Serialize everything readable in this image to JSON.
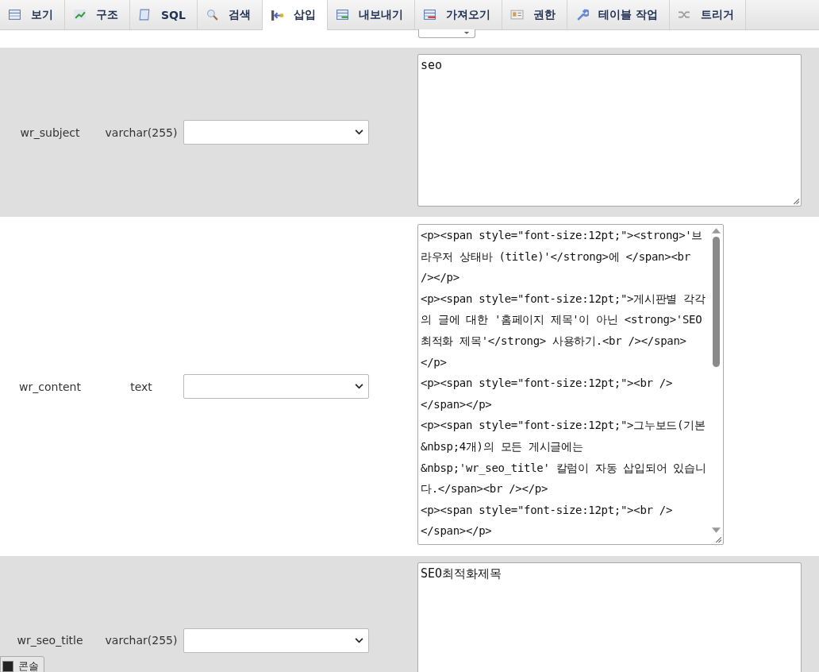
{
  "tabs": [
    {
      "label": "보기",
      "selected": false
    },
    {
      "label": "구조",
      "selected": false
    },
    {
      "label": "SQL",
      "selected": false
    },
    {
      "label": "검색",
      "selected": false
    },
    {
      "label": "삽입",
      "selected": true
    },
    {
      "label": "내보내기",
      "selected": false
    },
    {
      "label": "가져오기",
      "selected": false
    },
    {
      "label": "권한",
      "selected": false
    },
    {
      "label": "테이블 작업",
      "selected": false
    },
    {
      "label": "트리거",
      "selected": false
    }
  ],
  "rows": [
    {
      "name": "wr_subject",
      "type": "varchar(255)",
      "value": "seo",
      "kind": "plain"
    },
    {
      "name": "wr_content",
      "type": "text",
      "value": "<p><span style=\"font-size:12pt;\"><strong>'브라우저 상태바 (title)'</strong>에 </span><br /></p>\n<p><span style=\"font-size:12pt;\">게시판별 각각의 글에 대한 '홈페이지 제목'이 아닌 <strong>'SEO 최적화 제목'</strong> 사용하기.<br /></span></p>\n<p><span style=\"font-size:12pt;\"><br />\n</span></p>\n<p><span style=\"font-size:12pt;\">그누보드(기본&nbsp;4개)의 모든 게시글에는 &nbsp;'wr_seo_title' 칼럼이 자동 삽입되어 있습니다.</span><br /></p>\n<p><span style=\"font-size:12pt;\"><br />\n</span></p>",
      "kind": "scroll"
    },
    {
      "name": "wr_seo_title",
      "type": "varchar(255)",
      "value": "SEO최적화제목",
      "kind": "plain"
    }
  ],
  "console": {
    "label": "콘솔"
  }
}
